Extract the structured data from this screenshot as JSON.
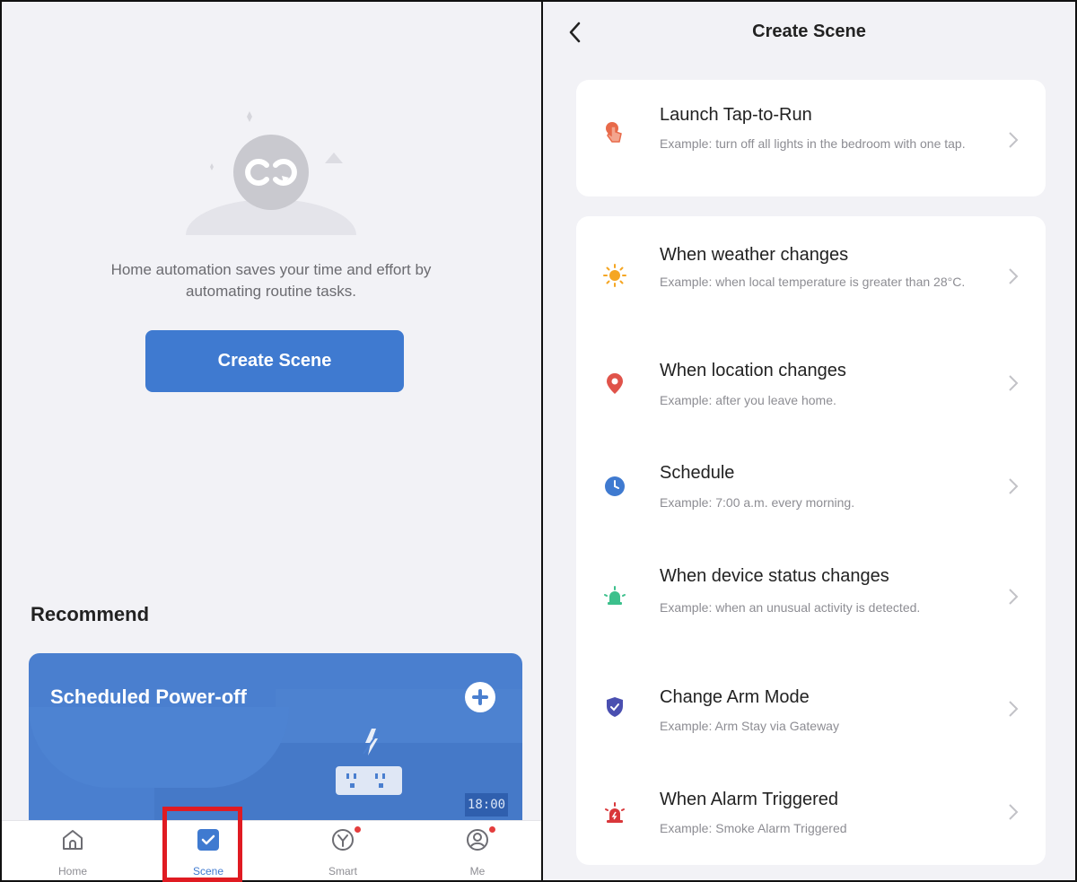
{
  "left": {
    "empty_text_line1": "Home automation saves your time and effort by",
    "empty_text_line2": "automating routine tasks.",
    "create_button": "Create Scene",
    "recommend_title": "Recommend",
    "card": {
      "title": "Scheduled Power-off",
      "clock_text": "18:00"
    },
    "tabs": [
      {
        "label": "Home",
        "icon": "home-icon"
      },
      {
        "label": "Scene",
        "icon": "scene-check-icon"
      },
      {
        "label": "Smart",
        "icon": "smart-icon"
      },
      {
        "label": "Me",
        "icon": "profile-icon"
      }
    ]
  },
  "right": {
    "nav_title": "Create Scene",
    "items": [
      {
        "title": "Launch Tap-to-Run",
        "desc": "Example: turn off all lights in the bedroom with one tap.",
        "icon": "tap-hand-icon",
        "color": "#e86a4a"
      },
      {
        "title": "When weather changes",
        "desc": "Example: when local temperature is greater than 28°C.",
        "icon": "sun-icon",
        "color": "#f5a623"
      },
      {
        "title": "When location changes",
        "desc": "Example: after you leave home.",
        "icon": "location-pin-icon",
        "color": "#e0534a"
      },
      {
        "title": "Schedule",
        "desc": "Example: 7:00 a.m. every morning.",
        "icon": "clock-icon",
        "color": "#3f7ad0"
      },
      {
        "title": "When device status changes",
        "desc": "Example: when an unusual activity is detected.",
        "icon": "device-bulb-icon",
        "color": "#3cc08c"
      },
      {
        "title": "Change Arm Mode",
        "desc": "Example: Arm Stay via Gateway",
        "icon": "shield-icon",
        "color": "#4a4fb0"
      },
      {
        "title": "When Alarm Triggered",
        "desc": "Example: Smoke Alarm Triggered",
        "icon": "alarm-icon",
        "color": "#d9373a"
      }
    ]
  },
  "colors": {
    "accent": "#3f7ad0",
    "background": "#f2f2f6",
    "highlight": "#e01b22"
  }
}
